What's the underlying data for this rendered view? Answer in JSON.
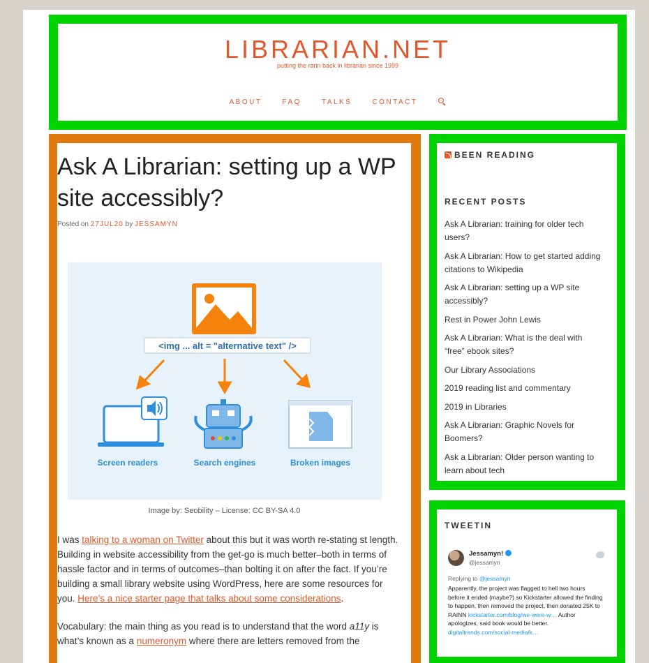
{
  "header": {
    "site_title": "LIBRARIAN.NET",
    "tagline": "putting the rarin back in librarian since 1999",
    "nav": [
      "ABOUT",
      "FAQ",
      "TALKS",
      "CONTACT"
    ]
  },
  "post": {
    "title": "Ask A Librarian: setting up a WP site accessibly?",
    "meta_prefix": "Posted on",
    "date": "27JUL20",
    "meta_by": "by",
    "author": "JESSAMYN",
    "figure": {
      "code_label": "<img ... alt = \"alternative text\" />",
      "labels": [
        "Screen readers",
        "Search engines",
        "Broken images"
      ]
    },
    "caption": "Image by: Seobility – License: CC BY-SA 4.0",
    "p1": {
      "t1": "I was ",
      "link1": "talking to a woman on Twitter",
      "t2": " about this but it was worth re-stating st length. Building in website accessibility from the get-go is much better–both in terms of hassle factor and in terms of outcomes–than bolting it on after the fact. If you’re building a small library website using WordPress, here are some resources for you. ",
      "link2": "Here’s a nice starter page that talks about some considerations",
      "t3": "."
    },
    "p2": {
      "t1": "Vocabulary: the main thing as you read is to understand that the word ",
      "em": "a11y",
      "t2": " is what’s known as a ",
      "link": "numeronym",
      "t3": " where there are letters removed from the"
    }
  },
  "sidebar": {
    "been_reading": "BEEN READING",
    "recent_title": "RECENT POSTS",
    "recent_posts": [
      "Ask A Librarian: training for older tech users?",
      "Ask A Librarian: How to get started adding citations to Wikipedia",
      "Ask A Librarian: setting up a WP site accessibly?",
      "Rest in Power John Lewis",
      "Ask A Librarian: What is the deal with “free” ebook sites?",
      "Our Library Associations",
      "2019 reading list and commentary",
      "2019 in Libraries",
      "Ask A Librarian: Graphic Novels for Boomers?",
      "Ask a Librarian: Older person wanting to learn about tech"
    ],
    "tweetin_title": "TWEETIN",
    "tweet": {
      "name": "Jessamyn!",
      "handle": "@jessamyn",
      "reply_prefix": "Replying to ",
      "reply_to": "@jessamyn",
      "text1": "Apparently, the project was flagged to hell two hours before it ended (maybe?) so Kickstarter allowed the finding to happen, then removed the project, then donated 25K to RAINN ",
      "link1": "kickstarter.com/blog/we-were-w…",
      "text2": " Author apologizes, said book would be better. ",
      "link2": "digitaltrends.com/social-media/k…"
    }
  },
  "colors": {
    "accent": "#e2582a",
    "frame_green": "#00d400",
    "frame_orange": "#e07a0c",
    "figure_orange": "#f5820d",
    "figure_blue": "#2f8fdc"
  }
}
